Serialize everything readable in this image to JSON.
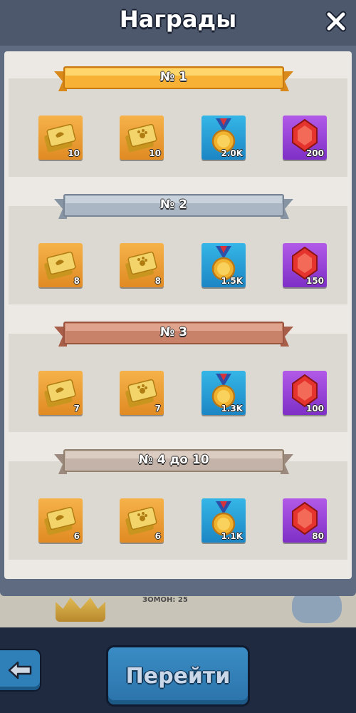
{
  "modal": {
    "title": "Награды",
    "close_icon": "close-icon"
  },
  "tiers": [
    {
      "label": "№ 1",
      "ribbon_color": "#f5a623",
      "rewards": [
        {
          "type": "ticket",
          "icon": "winged-ticket-icon",
          "count": "10"
        },
        {
          "type": "ticket",
          "icon": "paw-ticket-icon",
          "count": "10"
        },
        {
          "type": "medal",
          "icon": "medal-icon",
          "count": "2.0K"
        },
        {
          "type": "gem",
          "icon": "gem-icon",
          "count": "200"
        }
      ]
    },
    {
      "label": "№ 2",
      "ribbon_color": "#aab6c4",
      "rewards": [
        {
          "type": "ticket",
          "icon": "winged-ticket-icon",
          "count": "8"
        },
        {
          "type": "ticket",
          "icon": "paw-ticket-icon",
          "count": "8"
        },
        {
          "type": "medal",
          "icon": "medal-icon",
          "count": "1.5K"
        },
        {
          "type": "gem",
          "icon": "gem-icon",
          "count": "150"
        }
      ]
    },
    {
      "label": "№ 3",
      "ribbon_color": "#c9826a",
      "rewards": [
        {
          "type": "ticket",
          "icon": "winged-ticket-icon",
          "count": "7"
        },
        {
          "type": "ticket",
          "icon": "paw-ticket-icon",
          "count": "7"
        },
        {
          "type": "medal",
          "icon": "medal-icon",
          "count": "1.3K"
        },
        {
          "type": "gem",
          "icon": "gem-icon",
          "count": "100"
        }
      ]
    },
    {
      "label": "№ 4 до 10",
      "ribbon_color": "#c4b3a8",
      "rewards": [
        {
          "type": "ticket",
          "icon": "winged-ticket-icon",
          "count": "6"
        },
        {
          "type": "ticket",
          "icon": "paw-ticket-icon",
          "count": "6"
        },
        {
          "type": "medal",
          "icon": "medal-icon",
          "count": "1.1K"
        },
        {
          "type": "gem",
          "icon": "gem-icon",
          "count": "80"
        }
      ]
    }
  ],
  "background": {
    "partial_text": "ЗОМОН: 25"
  },
  "footer": {
    "back_icon": "back-arrow-icon",
    "go_label": "Перейти"
  }
}
